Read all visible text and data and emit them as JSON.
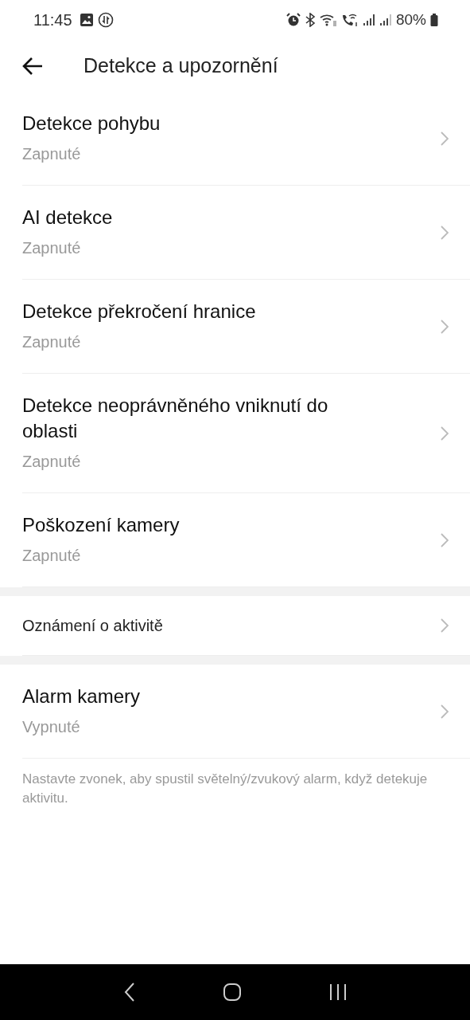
{
  "status_bar": {
    "time": "11:45",
    "battery": "80%"
  },
  "header": {
    "title": "Detekce a upozornění"
  },
  "sections": [
    {
      "items": [
        {
          "title": "Detekce pohybu",
          "status": "Zapnuté"
        },
        {
          "title": "AI detekce",
          "status": "Zapnuté"
        },
        {
          "title": "Detekce překročení hranice",
          "status": "Zapnuté"
        },
        {
          "title": "Detekce neoprávněného vniknutí do oblasti",
          "status": "Zapnuté"
        },
        {
          "title": "Poškození kamery",
          "status": "Zapnuté"
        }
      ]
    },
    {
      "items": [
        {
          "title": "Oznámení o aktivitě"
        }
      ]
    },
    {
      "items": [
        {
          "title": "Alarm kamery",
          "status": "Vypnuté"
        }
      ],
      "note": "Nastavte zvonek, aby spustil světelný/zvukový alarm, když detekuje aktivitu."
    }
  ]
}
